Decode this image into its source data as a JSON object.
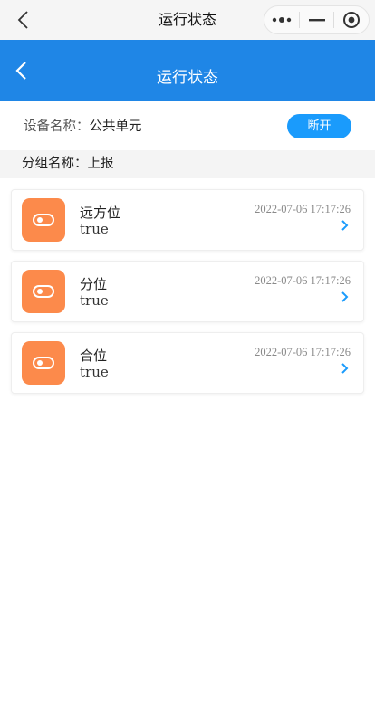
{
  "miniprogram": {
    "title": "运行状态"
  },
  "header": {
    "title": "运行状态"
  },
  "device": {
    "label": "设备名称：",
    "name": "公共单元",
    "action_label": "断开"
  },
  "group": {
    "label": "分组名称：",
    "name": "上报"
  },
  "items": [
    {
      "name": "远方位",
      "value": "true",
      "time": "2022-07-06 17:17:26"
    },
    {
      "name": "分位",
      "value": "true",
      "time": "2022-07-06 17:17:26"
    },
    {
      "name": "合位",
      "value": "true",
      "time": "2022-07-06 17:17:26"
    }
  ],
  "colors": {
    "header_bg": "#1f86e6",
    "button_bg": "#1a9bfc",
    "icon_bg": "#fc8a4b",
    "arrow": "#1a9bfc"
  }
}
